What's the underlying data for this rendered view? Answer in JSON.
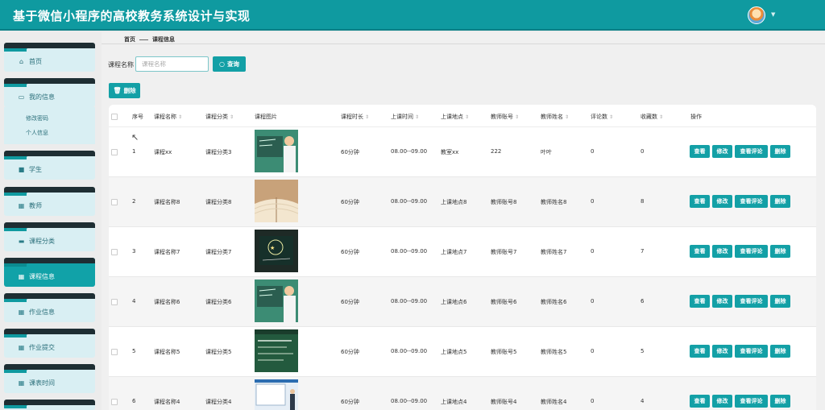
{
  "app": {
    "title": "基于微信小程序的高校教务系统设计与实现"
  },
  "sidebar": {
    "home": "首页",
    "my_info": "我的信息",
    "sub": [
      "修改密码",
      "个人信息"
    ],
    "items": [
      {
        "label": "学生",
        "icon": "user-icon"
      },
      {
        "label": "教师",
        "icon": "grid-icon"
      },
      {
        "label": "课程分类",
        "icon": "chat-icon"
      },
      {
        "label": "课程信息",
        "icon": "grid-icon",
        "active": true
      },
      {
        "label": "作业信息",
        "icon": "table-icon"
      },
      {
        "label": "作业提交",
        "icon": "grid-icon"
      },
      {
        "label": "课表时间",
        "icon": "grid-icon"
      }
    ]
  },
  "breadcrumb": {
    "home": "首页",
    "current": "课程信息"
  },
  "search": {
    "label": "课程名称",
    "placeholder": "课程名称",
    "button": "查询"
  },
  "toolbar": {
    "delete": "删除"
  },
  "table": {
    "headers": [
      "序号",
      "课程名称",
      "课程分类",
      "课程图片",
      "课程时长",
      "上课时间",
      "上课地点",
      "教师账号",
      "教师姓名",
      "评论数",
      "收藏数",
      "操作"
    ],
    "actions": [
      "查看",
      "修改",
      "查看评论",
      "删除"
    ],
    "rows": [
      {
        "no": "1",
        "name": "课程xx",
        "category": "课程分类3",
        "duration": "60分钟",
        "time": "08.00--09.00",
        "place": "教室xx",
        "teacher_account": "222",
        "teacher_name": "叶叶",
        "comments": "0",
        "favorites": "0",
        "image": "teacher-blackboard"
      },
      {
        "no": "2",
        "name": "课程名称8",
        "category": "课程分类8",
        "duration": "60分钟",
        "time": "08.00--09.00",
        "place": "上课地点8",
        "teacher_account": "教师账号8",
        "teacher_name": "教师姓名8",
        "comments": "0",
        "favorites": "8",
        "image": "open-book"
      },
      {
        "no": "3",
        "name": "课程名称7",
        "category": "课程分类7",
        "duration": "60分钟",
        "time": "08.00--09.00",
        "place": "上课地点7",
        "teacher_account": "教师账号7",
        "teacher_name": "教师姓名7",
        "comments": "0",
        "favorites": "7",
        "image": "chalkboard"
      },
      {
        "no": "4",
        "name": "课程名称6",
        "category": "课程分类6",
        "duration": "60分钟",
        "time": "08.00--09.00",
        "place": "上课地点6",
        "teacher_account": "教师账号6",
        "teacher_name": "教师姓名6",
        "comments": "0",
        "favorites": "6",
        "image": "teacher-blackboard"
      },
      {
        "no": "5",
        "name": "课程名称5",
        "category": "课程分类5",
        "duration": "60分钟",
        "time": "08.00--09.00",
        "place": "上课地点5",
        "teacher_account": "教师账号5",
        "teacher_name": "教师姓名5",
        "comments": "0",
        "favorites": "5",
        "image": "green-board"
      },
      {
        "no": "6",
        "name": "课程名称4",
        "category": "课程分类4",
        "duration": "60分钟",
        "time": "08.00--09.00",
        "place": "上课地点4",
        "teacher_account": "教师账号4",
        "teacher_name": "教师姓名4",
        "comments": "0",
        "favorites": "4",
        "image": "lecture-screen"
      }
    ]
  },
  "colors": {
    "primary": "#0f9aa0",
    "button": "#13a0a6",
    "nav_bg": "#d9eff3"
  }
}
